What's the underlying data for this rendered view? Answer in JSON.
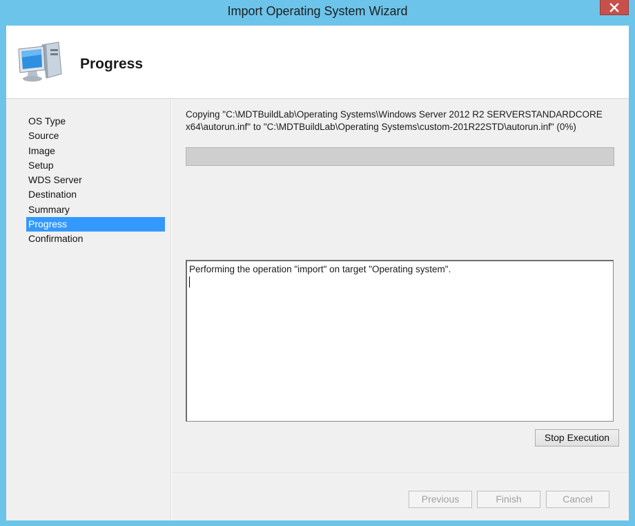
{
  "window": {
    "title": "Import Operating System Wizard",
    "accent_color": "#6cc4ea",
    "close_icon": "close-icon"
  },
  "header": {
    "icon": "computer-icon",
    "heading": "Progress"
  },
  "sidebar": {
    "items": [
      {
        "label": "OS Type",
        "active": false
      },
      {
        "label": "Source",
        "active": false
      },
      {
        "label": "Image",
        "active": false
      },
      {
        "label": "Setup",
        "active": false
      },
      {
        "label": "WDS Server",
        "active": false
      },
      {
        "label": "Destination",
        "active": false
      },
      {
        "label": "Summary",
        "active": false
      },
      {
        "label": "Progress",
        "active": true
      },
      {
        "label": "Confirmation",
        "active": false
      }
    ],
    "active_color": "#3399ff"
  },
  "main": {
    "status_text": "Copying \"C:\\MDTBuildLab\\Operating Systems\\Windows Server 2012 R2 SERVERSTANDARDCORE x64\\autorun.inf\" to \"C:\\MDTBuildLab\\Operating Systems\\custom-201R22STD\\autorun.inf\" (0%)",
    "progress_fraction": 0,
    "log_text": "Performing the operation \"import\" on target \"Operating system\".",
    "stop_button": "Stop Execution"
  },
  "footer": {
    "previous": "Previous",
    "finish": "Finish",
    "cancel": "Cancel"
  }
}
